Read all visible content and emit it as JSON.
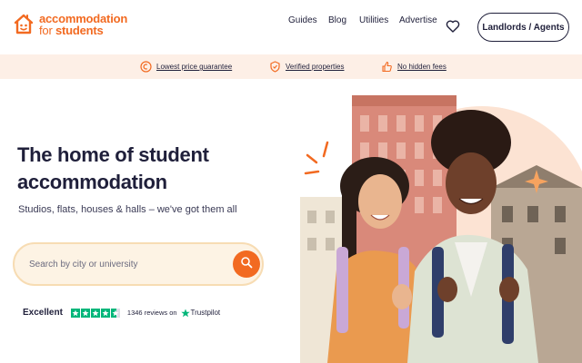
{
  "header": {
    "logo": {
      "line1": "accommodation",
      "line2_prefix": "for ",
      "line2_bold": "students"
    },
    "nav": [
      "Guides",
      "Blog",
      "Utilities",
      "Advertise"
    ],
    "landlords_label": "Landlords / Agents"
  },
  "trustbar": {
    "items": [
      "Lowest price guarantee",
      "Verified properties",
      "No hidden fees"
    ]
  },
  "hero": {
    "title_line1": "The home of student",
    "title_line2": "accommodation",
    "subtitle": "Studios, flats, houses & halls – we've got them all"
  },
  "search": {
    "placeholder": "Search by city or university"
  },
  "trustpilot": {
    "rating_label": "Excellent",
    "reviews": "1346 reviews on",
    "brand": "Trustpilot"
  },
  "colors": {
    "brand_orange": "#f26a21",
    "trustbar_bg": "#fdefe6",
    "text_dark": "#1f1f3a",
    "trustpilot_green": "#00b67a"
  },
  "icons": [
    "house-logo-icon",
    "heart-icon",
    "coin-icon",
    "shield-icon",
    "thumbs-up-icon",
    "search-icon",
    "star-icon"
  ]
}
